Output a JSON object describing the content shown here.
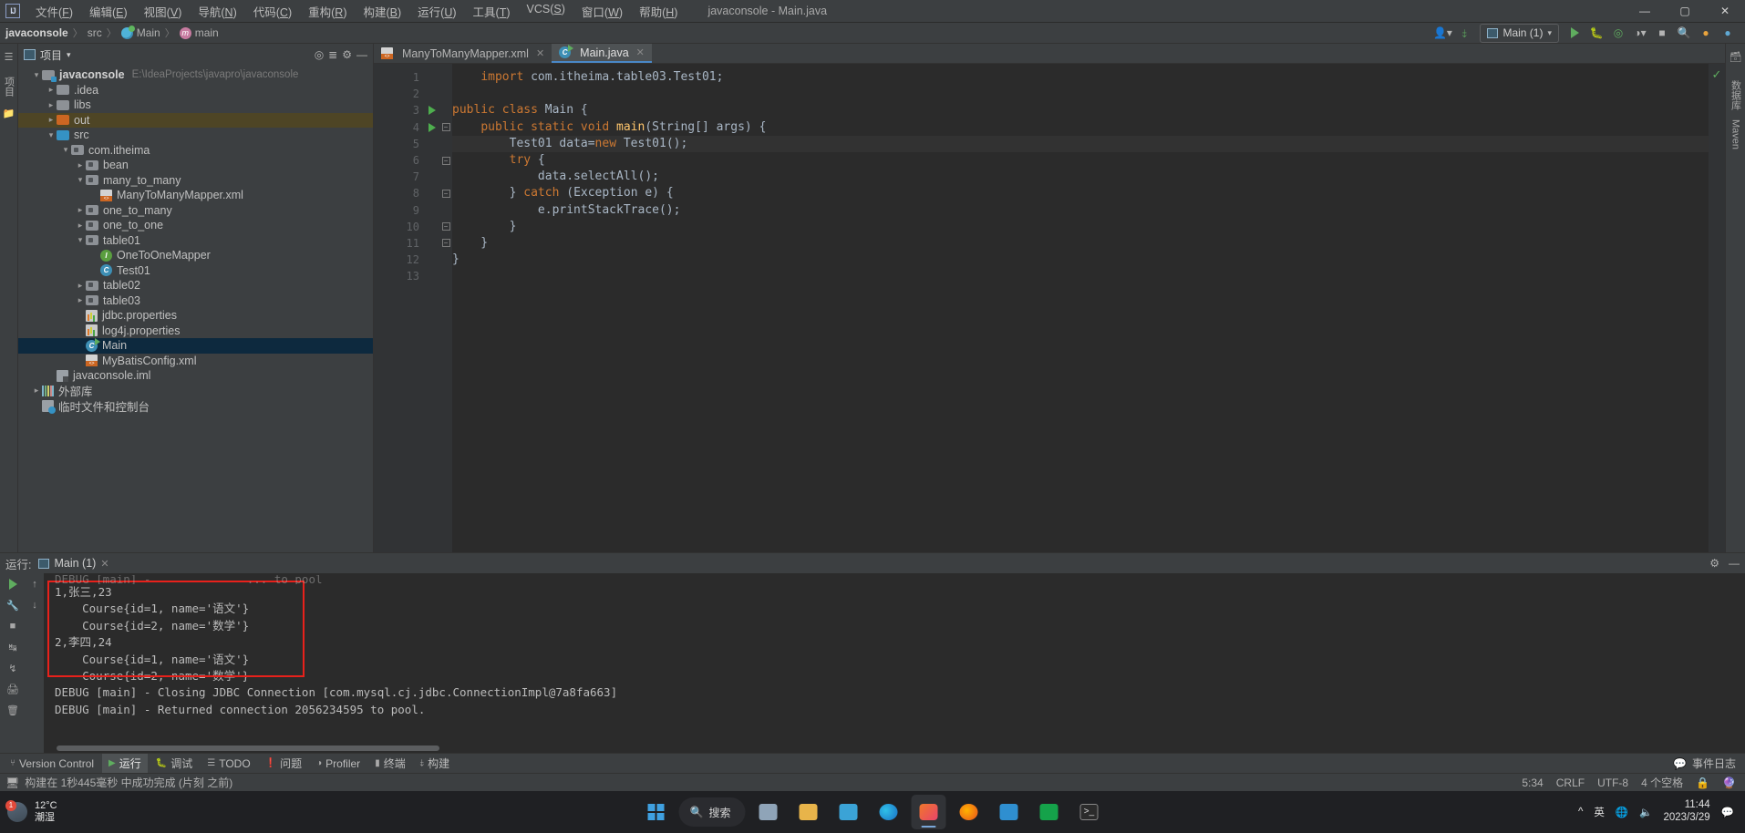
{
  "titlebar": {
    "logo": "IJ",
    "menus": [
      "文件(F)",
      "编辑(E)",
      "视图(V)",
      "导航(N)",
      "代码(C)",
      "重构(R)",
      "构建(B)",
      "运行(U)",
      "工具(T)",
      "VCS(S)",
      "窗口(W)",
      "帮助(H)"
    ],
    "window_title": "javaconsole - Main.java",
    "minimize": "—",
    "maximize": "▢",
    "close": "✕"
  },
  "navbar": {
    "crumbs": [
      "javaconsole",
      "src",
      "Main",
      "main"
    ],
    "separator": "〉"
  },
  "toolbar": {
    "run_config": "Main (1)",
    "icons": [
      "user-icon",
      "hammer-icon",
      "run-icon",
      "debug-icon",
      "coverage-icon",
      "profile-icon",
      "stop-icon",
      "search-icon",
      "update-icon",
      "idea-icon"
    ]
  },
  "left_strip": {
    "labels": [
      "项目"
    ]
  },
  "project_panel": {
    "title": "项目",
    "tools": [
      "target-icon",
      "collapse-icon",
      "settings-icon",
      "hide-icon"
    ],
    "tree": [
      {
        "depth": 0,
        "arrow": "v",
        "icon": "module",
        "label": "javaconsole",
        "bold": true,
        "path": "E:\\IdeaProjects\\javapro\\javaconsole",
        "state": "normal"
      },
      {
        "depth": 1,
        "arrow": ">",
        "icon": "folder-gray",
        "label": ".idea",
        "state": "normal"
      },
      {
        "depth": 1,
        "arrow": ">",
        "icon": "folder-gray",
        "label": "libs",
        "state": "normal"
      },
      {
        "depth": 1,
        "arrow": ">",
        "icon": "folder-orange",
        "label": "out",
        "state": "olive"
      },
      {
        "depth": 1,
        "arrow": "v",
        "icon": "folder-blue",
        "label": "src",
        "state": "normal"
      },
      {
        "depth": 2,
        "arrow": "v",
        "icon": "package",
        "label": "com.itheima",
        "state": "normal"
      },
      {
        "depth": 3,
        "arrow": ">",
        "icon": "package",
        "label": "bean",
        "state": "normal"
      },
      {
        "depth": 3,
        "arrow": "v",
        "icon": "package",
        "label": "many_to_many",
        "state": "normal"
      },
      {
        "depth": 4,
        "arrow": "",
        "icon": "xml",
        "label": "ManyToManyMapper.xml",
        "state": "normal"
      },
      {
        "depth": 3,
        "arrow": ">",
        "icon": "package",
        "label": "one_to_many",
        "state": "normal"
      },
      {
        "depth": 3,
        "arrow": ">",
        "icon": "package",
        "label": "one_to_one",
        "state": "normal"
      },
      {
        "depth": 3,
        "arrow": "v",
        "icon": "package",
        "label": "table01",
        "state": "normal"
      },
      {
        "depth": 4,
        "arrow": "",
        "icon": "interface",
        "label": "OneToOneMapper",
        "state": "normal"
      },
      {
        "depth": 4,
        "arrow": "",
        "icon": "class",
        "label": "Test01",
        "state": "normal"
      },
      {
        "depth": 3,
        "arrow": ">",
        "icon": "package",
        "label": "table02",
        "state": "normal"
      },
      {
        "depth": 3,
        "arrow": ">",
        "icon": "package",
        "label": "table03",
        "state": "normal"
      },
      {
        "depth": 3,
        "arrow": "",
        "icon": "properties",
        "label": "jdbc.properties",
        "state": "normal"
      },
      {
        "depth": 3,
        "arrow": "",
        "icon": "properties",
        "label": "log4j.properties",
        "state": "normal"
      },
      {
        "depth": 3,
        "arrow": "",
        "icon": "main-class",
        "label": "Main",
        "state": "selected"
      },
      {
        "depth": 3,
        "arrow": "",
        "icon": "xml",
        "label": "MyBatisConfig.xml",
        "state": "normal"
      },
      {
        "depth": 1,
        "arrow": "",
        "icon": "iml",
        "label": "javaconsole.iml",
        "state": "normal"
      },
      {
        "depth": 0,
        "arrow": ">",
        "icon": "library",
        "label": "外部库",
        "state": "normal"
      },
      {
        "depth": 0,
        "arrow": "",
        "icon": "scratch",
        "label": "临时文件和控制台",
        "state": "normal"
      }
    ]
  },
  "editor": {
    "tabs": [
      {
        "label": "ManyToManyMapper.xml",
        "icon": "xml",
        "active": false
      },
      {
        "label": "Main.java",
        "icon": "main-class",
        "active": true
      }
    ],
    "line_numbers": [
      "1",
      "2",
      "3",
      "4",
      "5",
      "6",
      "7",
      "8",
      "9",
      "10",
      "11",
      "12",
      "13"
    ],
    "gutter_run_lines": [
      3,
      4
    ],
    "highlight_line": 5,
    "code_lines": [
      {
        "n": 1,
        "html": "    <span class=\"kw\">import</span> com.itheima.table03.Test01;"
      },
      {
        "n": 2,
        "html": ""
      },
      {
        "n": 3,
        "html": "<span class=\"kw\">public class</span> <span class=\"cls\">Main</span> {"
      },
      {
        "n": 4,
        "html": "    <span class=\"kw\">public static void</span> <span class=\"meth\">main</span>(String[] args) {"
      },
      {
        "n": 5,
        "html": "        Test01 data=<span class=\"kw\">new</span> Test01();"
      },
      {
        "n": 6,
        "html": "        <span class=\"kw\">try</span> {"
      },
      {
        "n": 7,
        "html": "            data.selectAll();"
      },
      {
        "n": 8,
        "html": "        } <span class=\"kw\">catch</span> (Exception e) {"
      },
      {
        "n": 9,
        "html": "            e.printStackTrace();"
      },
      {
        "n": 10,
        "html": "        }"
      },
      {
        "n": 11,
        "html": "    }"
      },
      {
        "n": 12,
        "html": "}"
      },
      {
        "n": 13,
        "html": ""
      }
    ]
  },
  "right_strip": {
    "labels": [
      "数据库",
      "Maven"
    ]
  },
  "run_panel": {
    "label": "运行:",
    "tab": "Main (1)",
    "console_lines": [
      "DEBUG [main] -              ... to pool",
      "1,张三,23",
      "    Course{id=1, name='语文'}",
      "    Course{id=2, name='数学'}",
      "2,李四,24",
      "    Course{id=1, name='语文'}",
      "    Course{id=2, name='数学'}",
      "DEBUG [main] - Closing JDBC Connection [com.mysql.cj.jdbc.ConnectionImpl@7a8fa663]",
      "DEBUG [main] - Returned connection 2056234595 to pool."
    ],
    "highlight_color": "#e8211b"
  },
  "bottom_bar": {
    "items": [
      {
        "label": "Version Control",
        "icon": "branch-icon",
        "active": false
      },
      {
        "label": "运行",
        "icon": "run-icon",
        "active": true
      },
      {
        "label": "调试",
        "icon": "debug-icon",
        "active": false
      },
      {
        "label": "TODO",
        "icon": "list-icon",
        "active": false
      },
      {
        "label": "问题",
        "icon": "warning-icon",
        "active": false
      },
      {
        "label": "Profiler",
        "icon": "profiler-icon",
        "active": false
      },
      {
        "label": "终端",
        "icon": "terminal-icon",
        "active": false
      },
      {
        "label": "构建",
        "icon": "build-icon",
        "active": false
      }
    ],
    "right_label": "事件日志"
  },
  "status_bar": {
    "message": "构建在 1秒445毫秒 中成功完成 (片刻 之前)",
    "caret": "5:34",
    "line_sep": "CRLF",
    "encoding": "UTF-8",
    "indent": "4 个空格",
    "lock_icon": "lock-icon",
    "inspect_icon": "inspection-icon"
  },
  "taskbar": {
    "weather_temp": "12°C",
    "weather_desc": "潮湿",
    "search_placeholder": "搜索",
    "clock_time": "11:44",
    "clock_date": "2023/3/29",
    "lang": "英",
    "apps": [
      "start-icon",
      "search-icon",
      "taskview-icon",
      "explorer-icon",
      "store-icon",
      "edge-icon",
      "idea-icon",
      "firefox-icon",
      "vscode-icon",
      "netease-icon",
      "terminal-icon"
    ]
  }
}
